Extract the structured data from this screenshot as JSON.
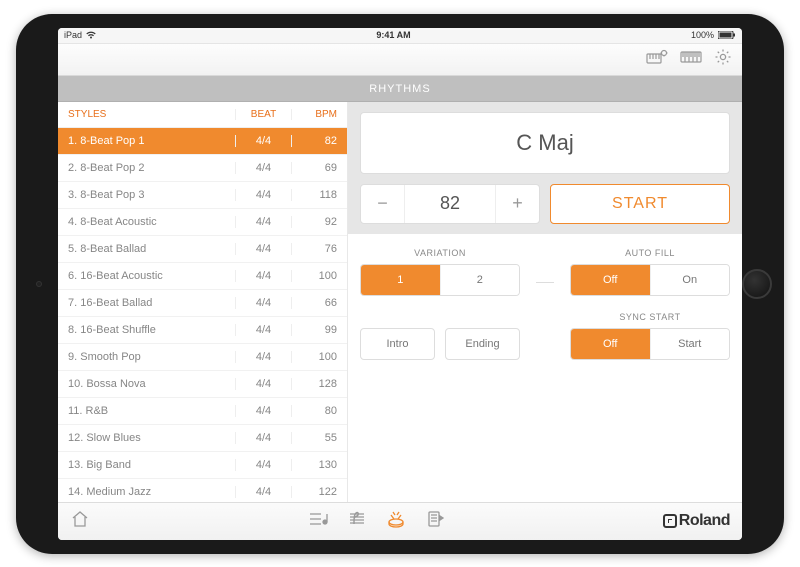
{
  "status_bar": {
    "carrier": "iPad",
    "time": "9:41 AM",
    "battery": "100%"
  },
  "section_title": "RHYTHMS",
  "styles_header": {
    "styles": "STYLES",
    "beat": "BEAT",
    "bpm": "BPM"
  },
  "styles": [
    {
      "name": "1.  8-Beat Pop 1",
      "beat": "4/4",
      "bpm": "82",
      "selected": true
    },
    {
      "name": "2.  8-Beat Pop 2",
      "beat": "4/4",
      "bpm": "69",
      "selected": false
    },
    {
      "name": "3.  8-Beat Pop 3",
      "beat": "4/4",
      "bpm": "118",
      "selected": false
    },
    {
      "name": "4.  8-Beat Acoustic",
      "beat": "4/4",
      "bpm": "92",
      "selected": false
    },
    {
      "name": "5.  8-Beat Ballad",
      "beat": "4/4",
      "bpm": "76",
      "selected": false
    },
    {
      "name": "6.  16-Beat Acoustic",
      "beat": "4/4",
      "bpm": "100",
      "selected": false
    },
    {
      "name": "7.  16-Beat Ballad",
      "beat": "4/4",
      "bpm": "66",
      "selected": false
    },
    {
      "name": "8.  16-Beat Shuffle",
      "beat": "4/4",
      "bpm": "99",
      "selected": false
    },
    {
      "name": "9.  Smooth Pop",
      "beat": "4/4",
      "bpm": "100",
      "selected": false
    },
    {
      "name": "10.  Bossa Nova",
      "beat": "4/4",
      "bpm": "128",
      "selected": false
    },
    {
      "name": "11.  R&B",
      "beat": "4/4",
      "bpm": "80",
      "selected": false
    },
    {
      "name": "12.  Slow Blues",
      "beat": "4/4",
      "bpm": "55",
      "selected": false
    },
    {
      "name": "13.  Big Band",
      "beat": "4/4",
      "bpm": "130",
      "selected": false
    },
    {
      "name": "14.  Medium Jazz",
      "beat": "4/4",
      "bpm": "122",
      "selected": false
    }
  ],
  "chord": "C Maj",
  "bpm_value": "82",
  "start_label": "START",
  "variation": {
    "label": "VARIATION",
    "options": [
      "1",
      "2"
    ],
    "selected": 0
  },
  "auto_fill": {
    "label": "AUTO FILL",
    "options": [
      "Off",
      "On"
    ],
    "selected": 0
  },
  "sync_start": {
    "label": "SYNC START",
    "options": [
      "Off",
      "Start"
    ],
    "selected": 0
  },
  "intro_label": "Intro",
  "ending_label": "Ending",
  "brand": "Roland"
}
